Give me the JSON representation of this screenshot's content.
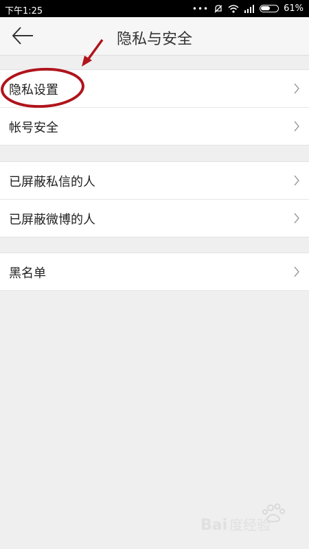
{
  "status_bar": {
    "time": "下午1:25",
    "battery": "61%",
    "battery_level": 0.61
  },
  "header": {
    "title": "隐私与安全",
    "back_icon": "arrow-left-icon"
  },
  "groups": [
    {
      "items": [
        {
          "label": "隐私设置"
        },
        {
          "label": "帐号安全"
        }
      ]
    },
    {
      "items": [
        {
          "label": "已屏蔽私信的人"
        },
        {
          "label": "已屏蔽微博的人"
        }
      ]
    },
    {
      "items": [
        {
          "label": "黑名单"
        }
      ]
    }
  ],
  "colors": {
    "annotation": "#b0141c",
    "background": "#efefef"
  },
  "watermark": {
    "text": "Bai度经验"
  }
}
